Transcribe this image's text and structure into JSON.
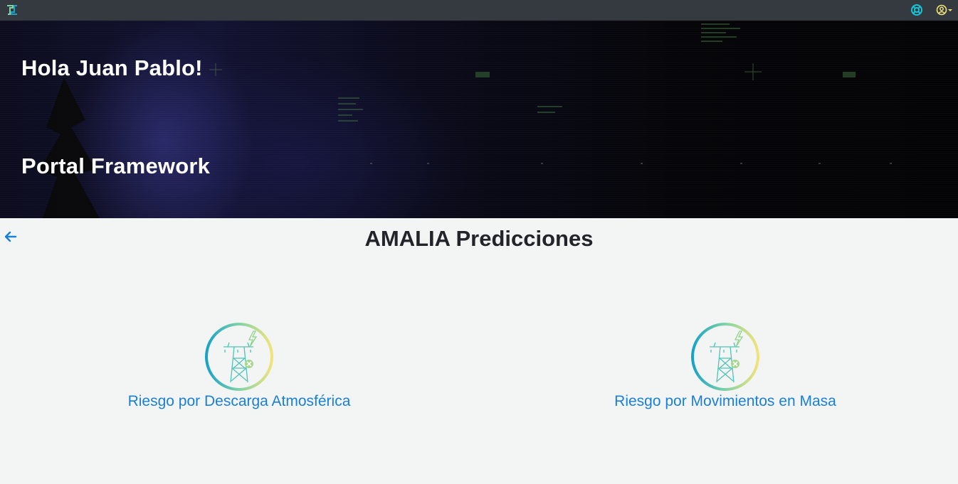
{
  "topbar": {
    "logo_icon": "app-logo-icon",
    "help_icon": "lifebuoy-icon",
    "user_icon": "user-circle-icon"
  },
  "hero": {
    "greeting": "Hola Juan Pablo!",
    "subtitle": "Portal Framework"
  },
  "main": {
    "back_icon": "arrow-left-icon",
    "title": "AMALIA Predicciones",
    "cards": [
      {
        "label": "Riesgo por Descarga Atmosférica",
        "icon": "power-tower-lightning-icon"
      },
      {
        "label": "Riesgo por Movimientos en Masa",
        "icon": "power-tower-lightning-icon"
      }
    ]
  },
  "colors": {
    "topbar": "#343a40",
    "link": "#1a7fd9",
    "background": "#f3f5f5",
    "ring_start": "#17a2c8",
    "ring_mid": "#7fd3a6",
    "ring_end": "#f1e37a"
  }
}
